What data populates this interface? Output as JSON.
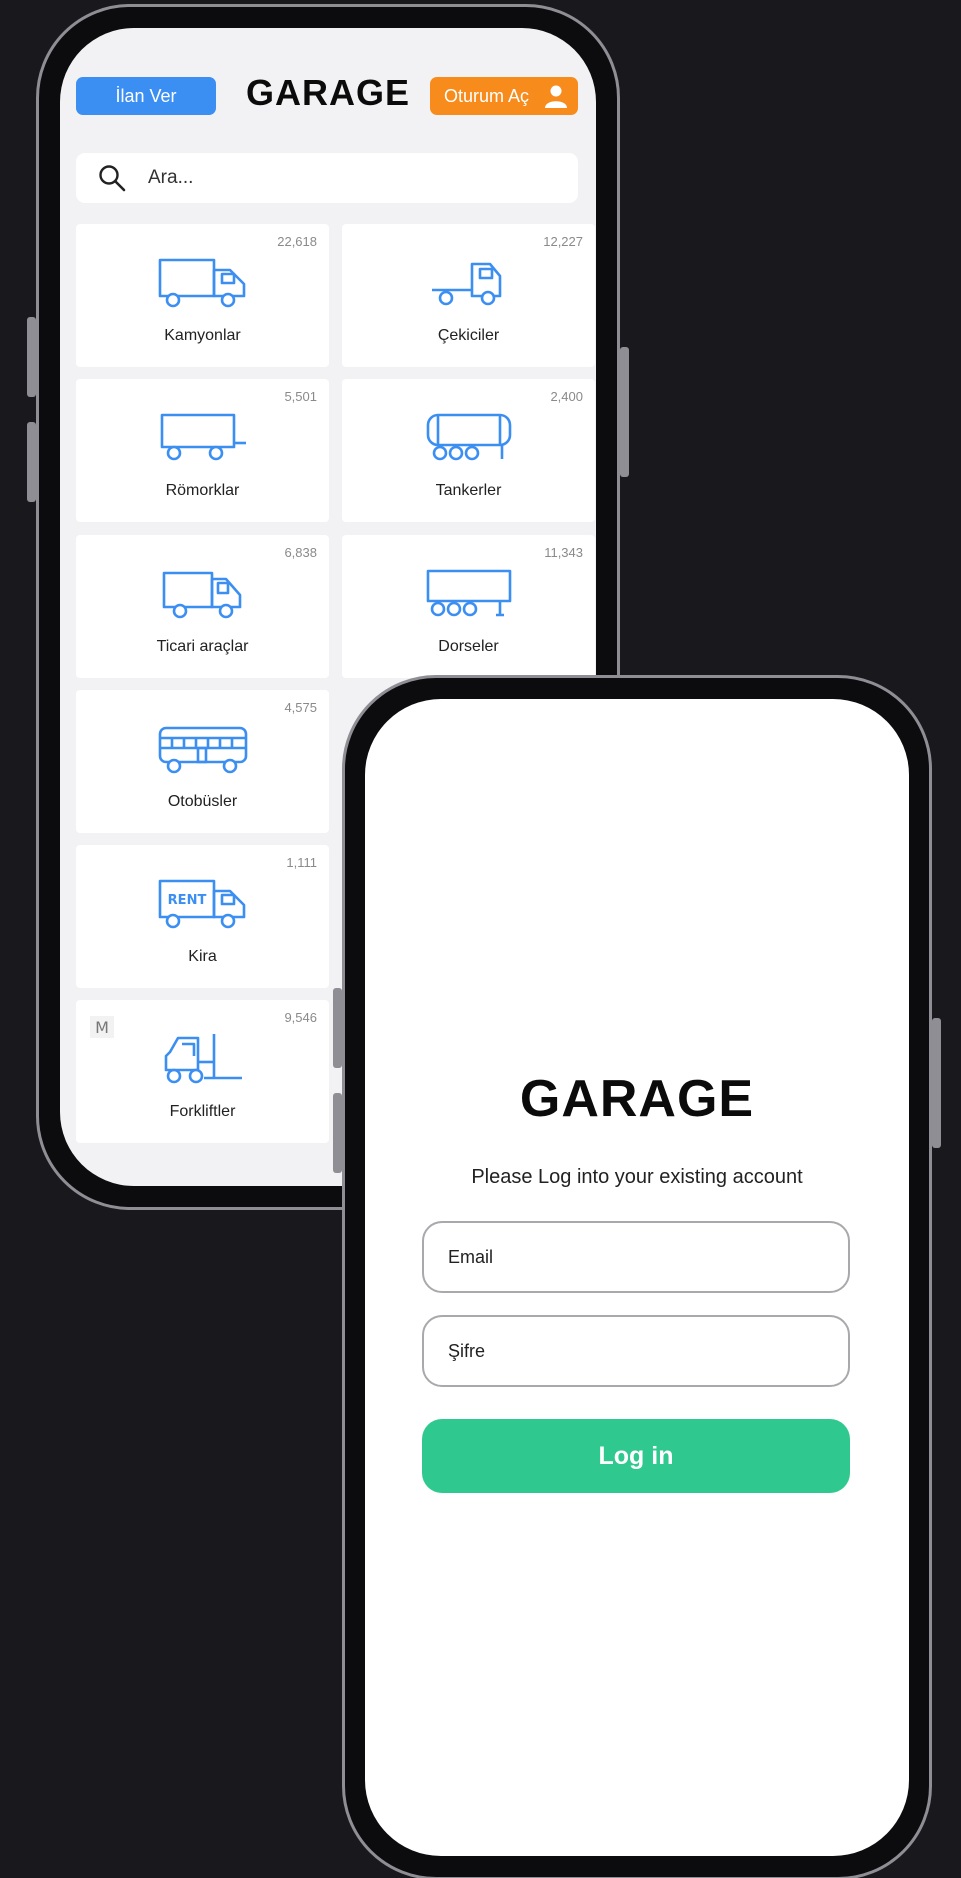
{
  "browse_screen": {
    "header": {
      "post_ad_label": "İlan Ver",
      "brand": "GARAGE",
      "sign_in_label": "Oturum Aç"
    },
    "search": {
      "placeholder": "Ara..."
    },
    "categories": [
      {
        "label": "Kamyonlar",
        "count": "22,618",
        "icon": "truck-icon"
      },
      {
        "label": "Çekiciler",
        "count": "12,227",
        "icon": "tractor-head-icon"
      },
      {
        "label": "Römorklar",
        "count": "5,501",
        "icon": "trailer-icon"
      },
      {
        "label": "Tankerler",
        "count": "2,400",
        "icon": "tanker-icon"
      },
      {
        "label": "Ticari araçlar",
        "count": "6,838",
        "icon": "van-icon"
      },
      {
        "label": "Dorseler",
        "count": "11,343",
        "icon": "semi-trailer-icon"
      },
      {
        "label": "Otobüsler",
        "count": "4,575",
        "icon": "bus-icon"
      },
      {
        "label": "Kira",
        "count": "1,111",
        "icon": "rent-truck-icon",
        "badge": "RENT"
      },
      {
        "label": "Forkliftler",
        "count": "9,546",
        "icon": "forklift-icon",
        "logo": "M"
      }
    ],
    "colors": {
      "primary": "#3b8ef2",
      "accent": "#f78c1d",
      "icon": "#3b8ef2"
    }
  },
  "login_screen": {
    "brand": "GARAGE",
    "subtitle": "Please Log into your existing account",
    "email_placeholder": "Email",
    "password_placeholder": "Şifre",
    "login_label": "Log in",
    "colors": {
      "login_button": "#2fc98f"
    }
  }
}
